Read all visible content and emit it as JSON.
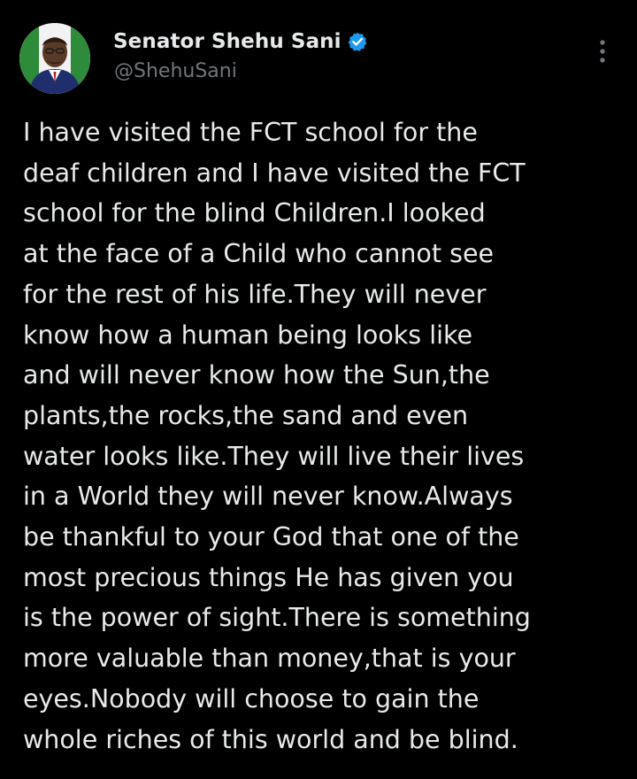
{
  "author": {
    "display_name": "Senator Shehu Sani",
    "handle": "@ShehuSani",
    "verified": true,
    "verified_icon": "verified-badge-icon",
    "verified_color": "#1d9bf0",
    "avatar_icon": "profile-avatar"
  },
  "menu": {
    "icon": "more-options-icon"
  },
  "post": {
    "lines": [
      "I have visited the FCT school for the",
      "deaf children and I have visited the FCT",
      "school for the blind Children.I looked",
      "at the face of a Child who cannot see",
      "for the rest of his life.They will never",
      "know how a human being looks like",
      "and will never know how the Sun,the",
      "plants,the rocks,the sand and even",
      "water looks like.They will live their lives",
      "in a World they will never know.Always",
      "be thankful to your God that one of the",
      "most precious things He has given you",
      "is the power of sight.There is something",
      "more valuable than money,that is your",
      "eyes.Nobody will choose to gain the",
      "whole riches of this world and be blind."
    ]
  },
  "colors": {
    "background": "#000000",
    "text_primary": "#e7e9ea",
    "text_secondary": "#71767b"
  }
}
